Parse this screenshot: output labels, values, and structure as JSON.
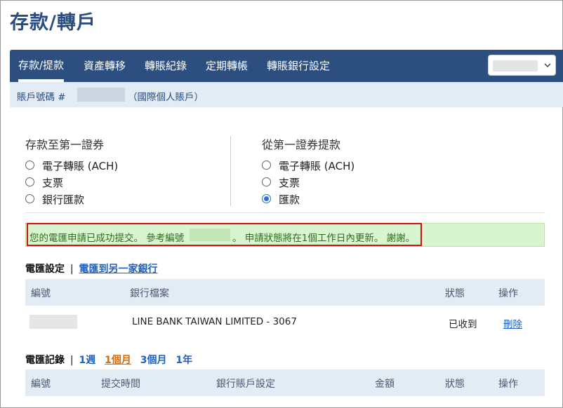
{
  "page": {
    "title": "存款/轉戶"
  },
  "nav": {
    "tabs": [
      {
        "label": "存款/提款",
        "active": true
      },
      {
        "label": "資產轉移",
        "active": false
      },
      {
        "label": "轉賬紀錄",
        "active": false
      },
      {
        "label": "定期轉帳",
        "active": false
      },
      {
        "label": "轉賬銀行設定",
        "active": false
      }
    ],
    "dropdown_icon": "chevron-down-icon"
  },
  "account": {
    "prefix": "賬戶號碼 #",
    "suffix": "（國際個人賬戶）"
  },
  "deposit": {
    "title": "存款至第一證券",
    "options": [
      {
        "label": "電子轉賬 (ACH)",
        "checked": false
      },
      {
        "label": "支票",
        "checked": false
      },
      {
        "label": "銀行匯款",
        "checked": false
      }
    ]
  },
  "withdraw": {
    "title": "從第一證券提款",
    "options": [
      {
        "label": "電子轉賬 (ACH)",
        "checked": false
      },
      {
        "label": "支票",
        "checked": false
      },
      {
        "label": "匯款",
        "checked": true
      }
    ]
  },
  "alert": {
    "part1": "您的電匯申請已成功提交。 參考編號",
    "part2": "。 申請狀態將在1個工作日內更新。 謝謝。"
  },
  "wire_settings": {
    "title": "電匯設定",
    "separator": "|",
    "link": "電匯到另一家銀行",
    "columns": [
      "編號",
      "銀行檔案",
      "狀態",
      "操作"
    ],
    "rows": [
      {
        "bank": "LINE BANK TAIWAN LIMITED - 3067",
        "status": "已收到",
        "action": "刪除"
      }
    ]
  },
  "wire_records": {
    "title": "電匯記錄",
    "separator": "|",
    "filters": [
      {
        "label": "1週",
        "active": false
      },
      {
        "label": "1個月",
        "active": true
      },
      {
        "label": "3個月",
        "active": false
      },
      {
        "label": "1年",
        "active": false
      }
    ],
    "columns": [
      "編號",
      "提交時間",
      "銀行賬戶設定",
      "金額",
      "狀態",
      "操作"
    ]
  },
  "colors": {
    "brand": "#2c4f80",
    "title": "#2b4c7e",
    "alert_bg": "#d8f5cf",
    "alert_text": "#2f6b1f",
    "highlight_border": "#cc1111",
    "link": "#1f5fbf",
    "active_filter": "#e06a00"
  }
}
